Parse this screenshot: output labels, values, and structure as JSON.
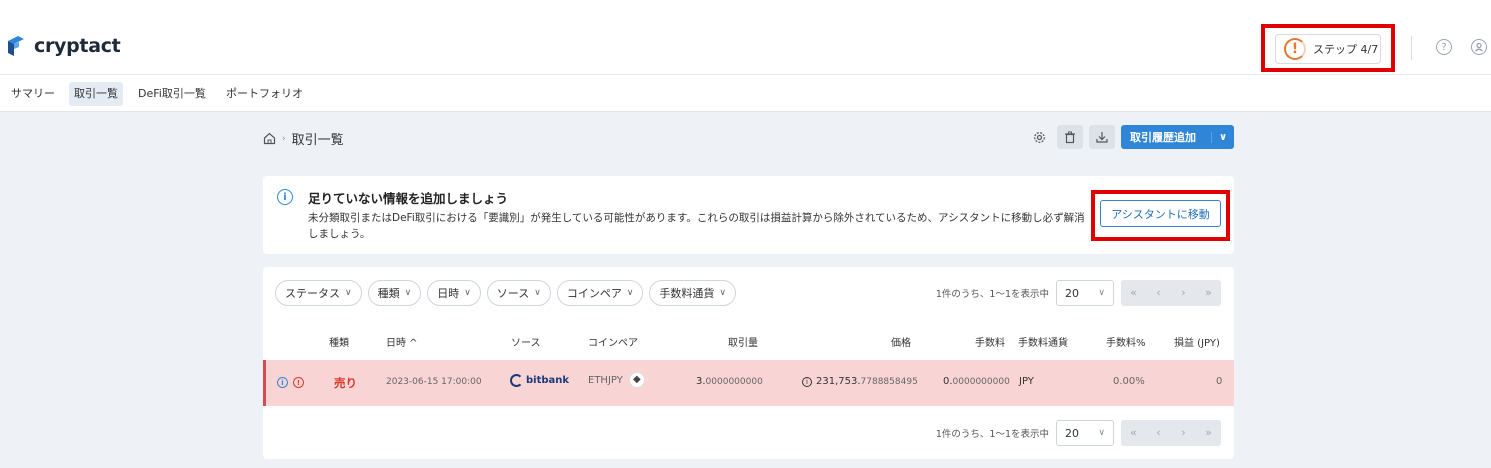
{
  "app": {
    "brand": "cryptact"
  },
  "header": {
    "step_label": "ステップ 4/7",
    "step_icon": "exclamation-progress-icon",
    "accent_color": "#e8772e",
    "help_icon": "help-circle-icon",
    "user_icon": "user-circle-icon"
  },
  "nav": {
    "items": [
      {
        "label": "サマリー"
      },
      {
        "label": "取引一覧",
        "active": true
      },
      {
        "label": "DeFi取引一覧"
      },
      {
        "label": "ポートフォリオ"
      }
    ]
  },
  "breadcrumb": {
    "page": "取引一覧"
  },
  "toolbar": {
    "settings_icon": "gear-icon",
    "delete_icon": "trash-icon",
    "download_icon": "download-icon",
    "add_label": "取引履歴追加",
    "add_color": "#2f86d8"
  },
  "alert": {
    "title": "足りていない情報を追加しましょう",
    "body": "未分類取引またはDeFi取引における「要識別」が発生している可能性があります。これらの取引は損益計算から除外されているため、アシスタントに移動し必ず解消しましょう。",
    "button_label": "アシスタントに移動"
  },
  "filters": [
    "ステータス",
    "種類",
    "日時",
    "ソース",
    "コインペア",
    "手数料通貨"
  ],
  "pagination": {
    "info": "1件のうち、1〜1を表示中",
    "page_size": "20",
    "first": "«",
    "prev": "‹",
    "next": "›",
    "last": "»"
  },
  "table": {
    "columns": {
      "type": "種類",
      "datetime": "日時 ^",
      "source": "ソース",
      "pair": "コインペア",
      "amount": "取引量",
      "price": "価格",
      "fee": "手数料",
      "fee_currency": "手数料通貨",
      "fee_pct": "手数料%",
      "pnl": "損益 (JPY)"
    },
    "rows": [
      {
        "type": "売り",
        "datetime": "2023-06-15 17:00:00",
        "source": "bitbank",
        "pair": "ETHJPY",
        "amount_int": "3.",
        "amount_dec": "0000000000",
        "price_int": "231,753.",
        "price_dec": "7788858495",
        "fee_int": "0.",
        "fee_dec": "0000000000",
        "fee_currency": "JPY",
        "fee_pct": "0.00%",
        "pnl": "0",
        "row_color": "#f8d4d4"
      }
    ]
  }
}
